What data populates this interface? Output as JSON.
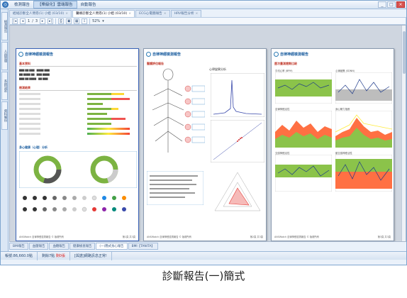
{
  "titlebar": {
    "menus": [
      "檢測報告",
      "【樂級化】雲端報告",
      "自動報告"
    ],
    "active_menu": 1,
    "buttons": [
      "_",
      "□",
      "×"
    ]
  },
  "sidebar": {
    "tabs": [
      "檢測報告",
      "人員管理",
      "系統設定",
      "資料備份"
    ]
  },
  "doc_tabs": [
    {
      "label": "經絡診斷全人問卷(1) 小姐 (03/10)",
      "active": false
    },
    {
      "label": "醫療診斷全人問卷(1) 小姐 (03/10)",
      "active": true
    },
    {
      "label": "ECG心電圖報告",
      "active": false
    },
    {
      "label": "HRV報告分析",
      "active": false
    }
  ],
  "toolbar": {
    "page_current": "1",
    "page_sep": "/",
    "page_total": "3",
    "zoom": "52%"
  },
  "pages": [
    {
      "title": "自律神經檢測報告",
      "section1": "基本資料",
      "section2": "檢測結果",
      "section3": "身心健康（心理）分析",
      "footer_left": "ANSWatch 自律神經檢測報告 © 版權所有",
      "footer_right": "第1頁 共3頁"
    },
    {
      "title": "自律神經檢測報告",
      "section1": "醫護評估報告",
      "section2": "心律變異分析",
      "footer_left": "ANSWatch 自律神經檢測報告 © 版權所有",
      "footer_right": "第2頁 共3頁"
    },
    {
      "title": "自律神經檢測報告",
      "section1": "歷次量測趨勢比較",
      "chart_titles": [
        "平均心率 (BPM)",
        "心律變異 (SDNN)",
        "自律神經活性",
        "身心壓力指數",
        "交感神經活性",
        "副交感神經活性"
      ],
      "footer_left": "ANSWatch 自律神經檢測報告 © 版權所有",
      "footer_right": "第3頁 共3頁"
    }
  ],
  "bottom_tabs": [
    {
      "label": "BMI報告",
      "active": false
    },
    {
      "label": "血壓報告",
      "active": false
    },
    {
      "label": "血糖報告",
      "active": false
    },
    {
      "label": "健康檢查報告",
      "active": false
    },
    {
      "label": "(一)簡式身心報告",
      "active": true
    },
    {
      "label": "BMI【TANITA】",
      "active": false
    }
  ],
  "statusbar": {
    "user": "帳號:86,660.0點",
    "remaining_label": "剩餘7點",
    "remaining_value": "剩0張",
    "message": "[與諾]網路訊息正常!"
  },
  "caption": "診斷報告(一)簡式",
  "colors": {
    "accent": "#2c6fb7",
    "brand": "#1d5fa0",
    "chart_green": "#8bc34a",
    "chart_orange": "#ff7043",
    "chart_yellow": "#ffeb3b"
  }
}
